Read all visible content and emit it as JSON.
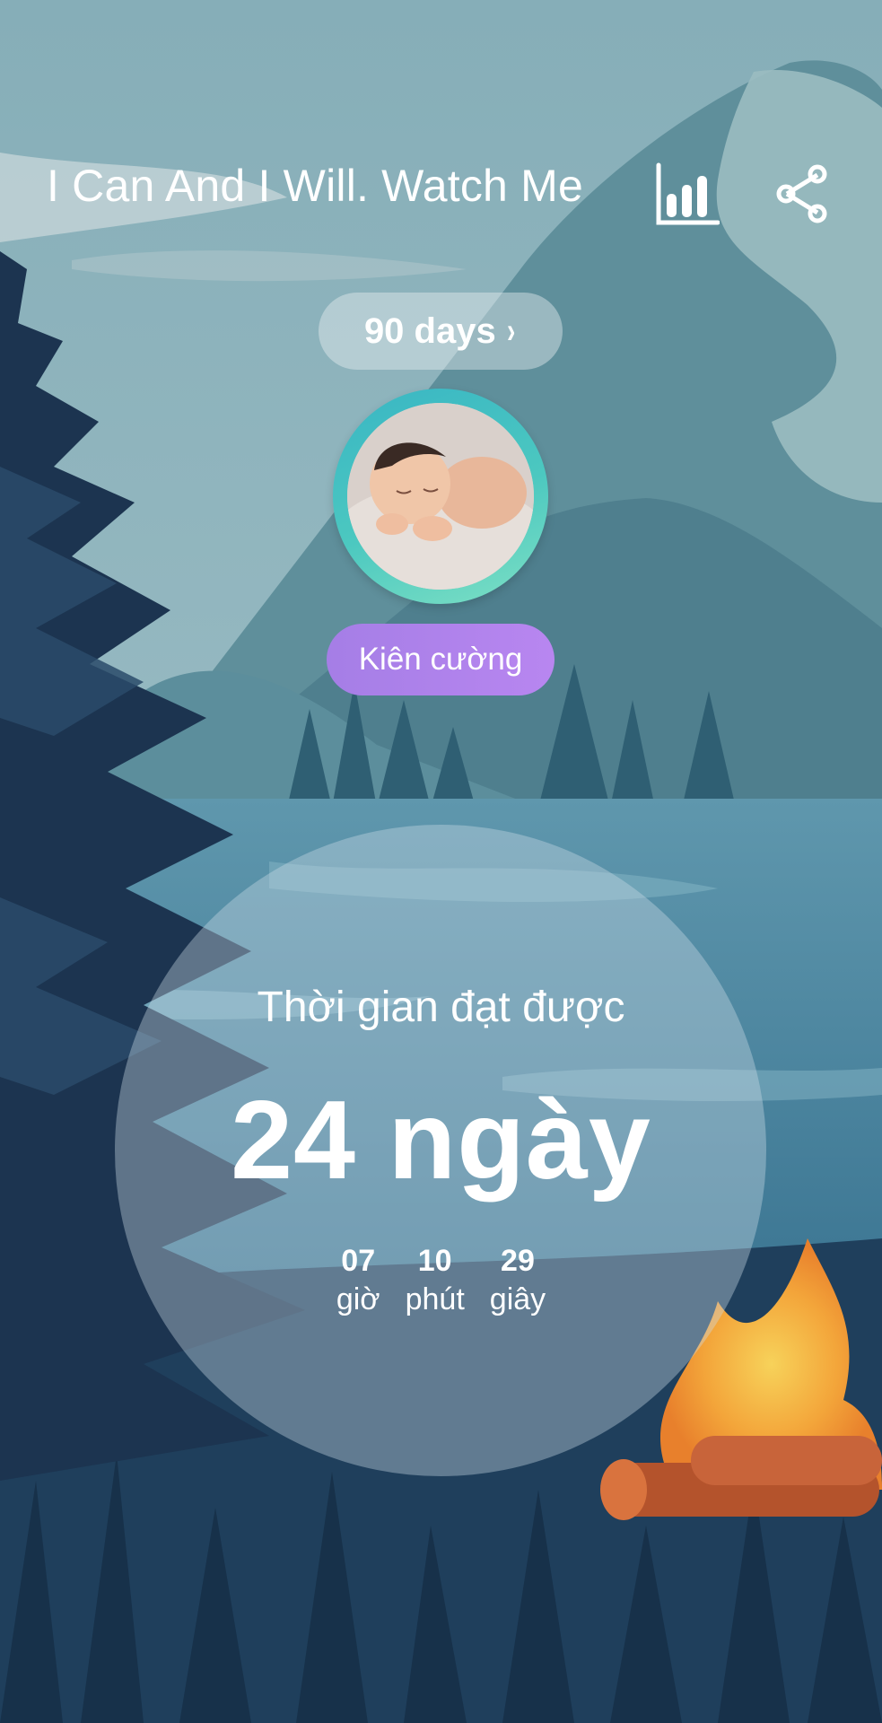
{
  "header": {
    "title": "I Can And I Will. Watch Me",
    "stats_icon": "bar-chart-icon",
    "share_icon": "share-icon"
  },
  "goal": {
    "label": "90 days",
    "chevron": "›"
  },
  "avatar": {
    "description_icon": "avatar"
  },
  "status": {
    "label": "Kiên cường"
  },
  "timer": {
    "label": "Thời gian đạt được",
    "days": "24 ngày",
    "hours_value": "07",
    "hours_label": "giờ",
    "minutes_value": "10",
    "minutes_label": "phút",
    "seconds_value": "29",
    "seconds_label": "giây"
  },
  "colors": {
    "status_tag": "#a57ee6",
    "avatar_ring": "#4cc8c0",
    "sky": "#8fb3bd"
  }
}
